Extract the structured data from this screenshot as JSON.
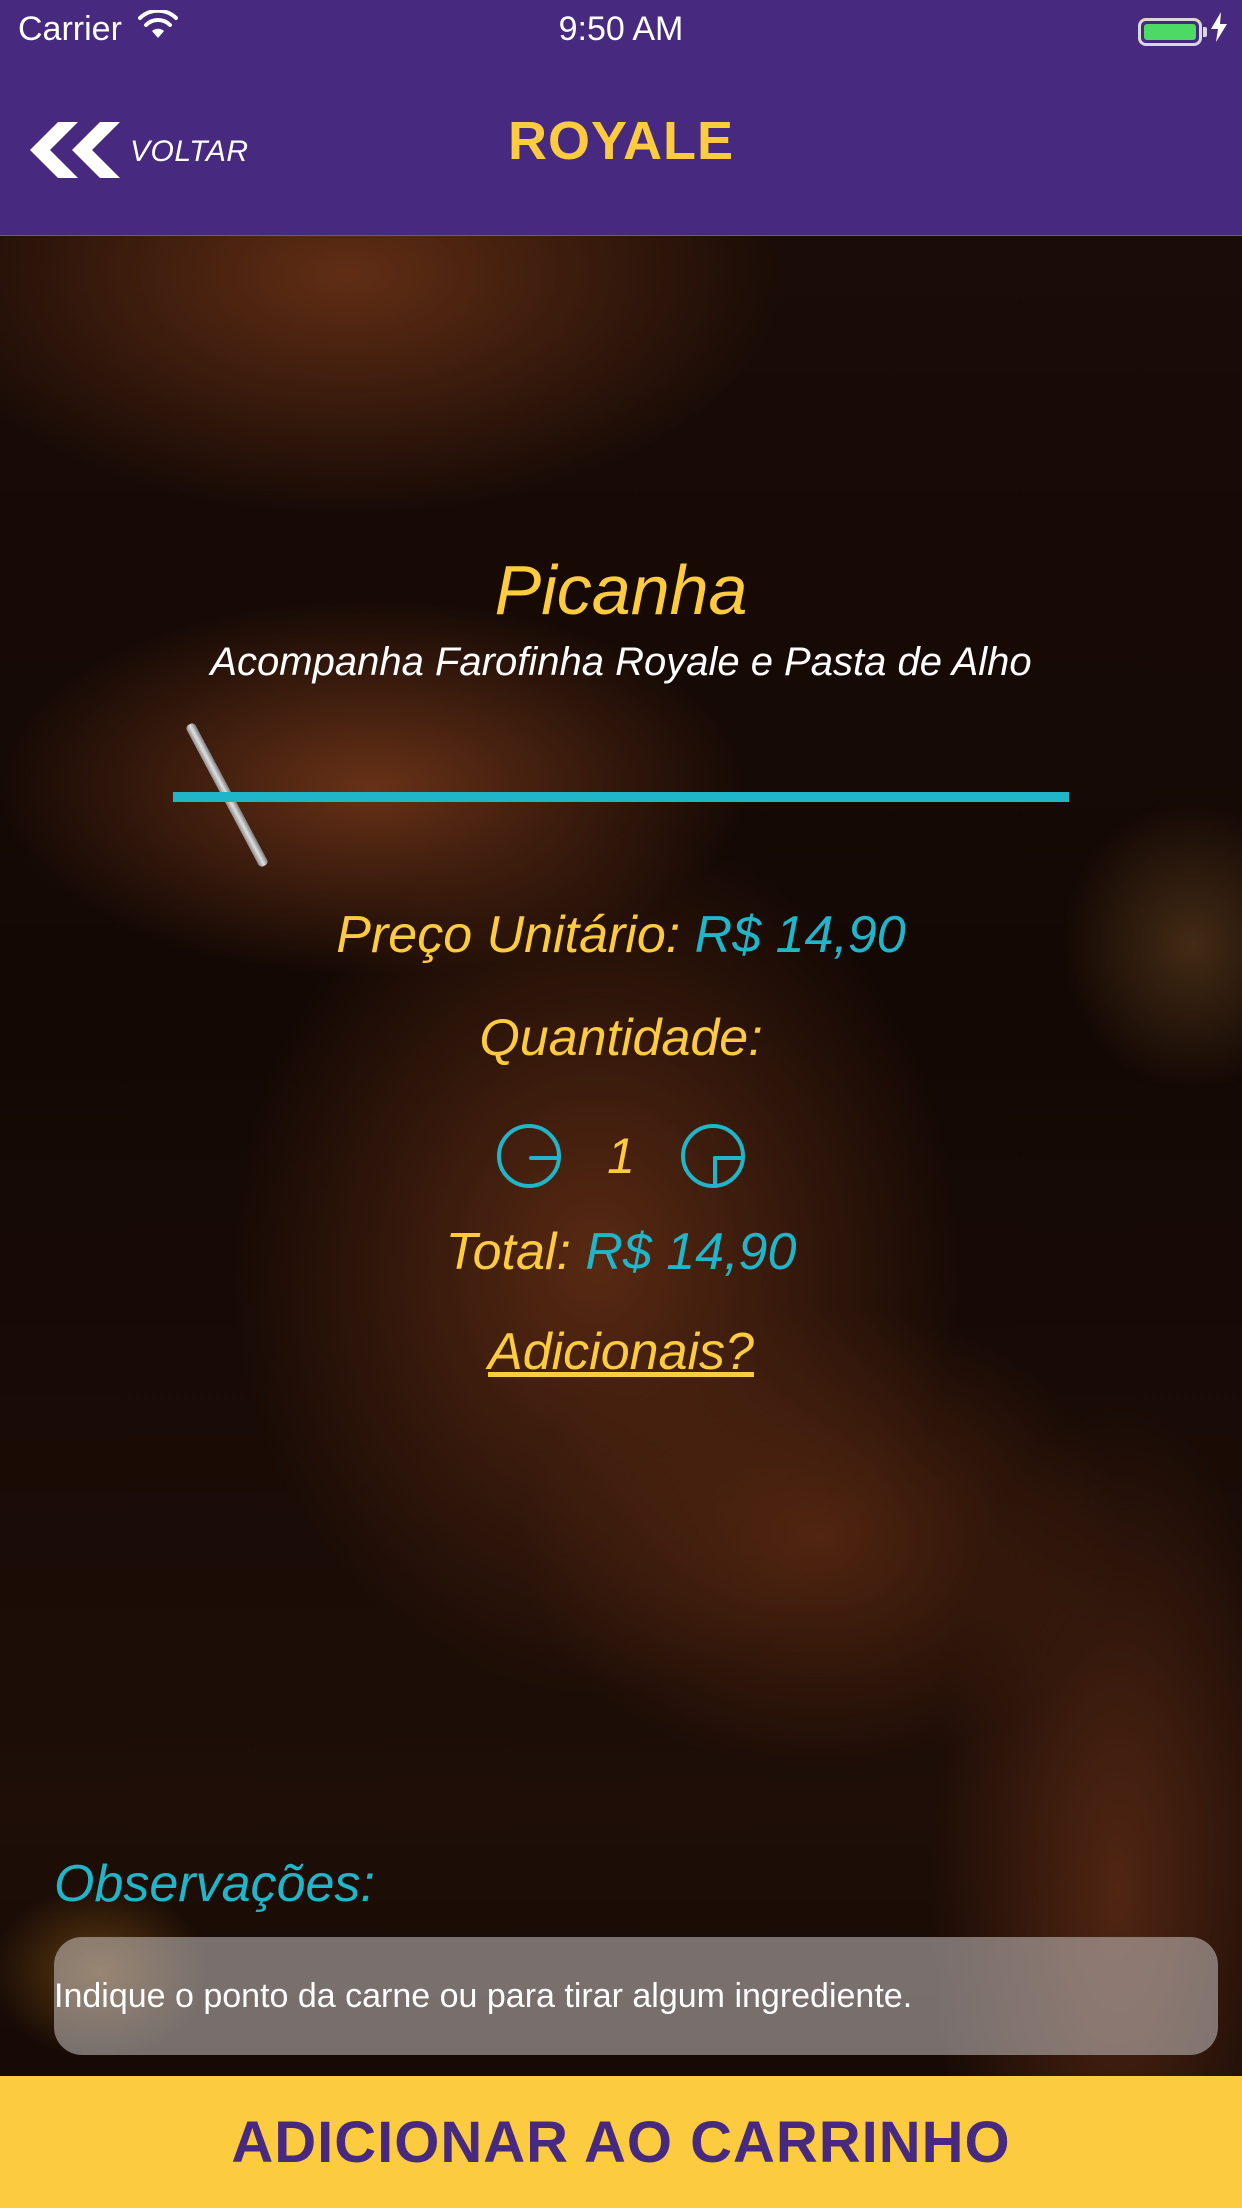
{
  "status_bar": {
    "carrier": "Carrier",
    "time": "9:50 AM",
    "icons": [
      "wifi-icon",
      "battery-icon",
      "charging-bolt-icon"
    ]
  },
  "nav": {
    "back_label": "VOLTAR",
    "back_icon": "double-chevron-left-icon",
    "title": "ROYALE"
  },
  "product": {
    "name": "Picanha",
    "description": "Acompanha Farofinha Royale e Pasta de Alho"
  },
  "pricing": {
    "unit_price_label": "Preço Unitário:",
    "unit_price_value": "R$ 14,90",
    "quantity_label": "Quantidade:",
    "quantity_value": "1",
    "minus_icon": "minus-circle-icon",
    "plus_icon": "plus-circle-icon",
    "total_label": "Total:",
    "total_value": "R$ 14,90",
    "extras_link": "Adicionais?"
  },
  "notes": {
    "label": "Observações:",
    "placeholder": "Indique o ponto da carne ou para tirar algum ingrediente."
  },
  "cta": {
    "label": "ADICIONAR AO CARRINHO"
  },
  "colors": {
    "header_bg": "#472a7f",
    "accent_yellow": "#fccb3f",
    "accent_teal": "#20b5c8",
    "cta_text": "#472a7f",
    "white": "#ffffff",
    "battery_green": "#4cd964"
  }
}
